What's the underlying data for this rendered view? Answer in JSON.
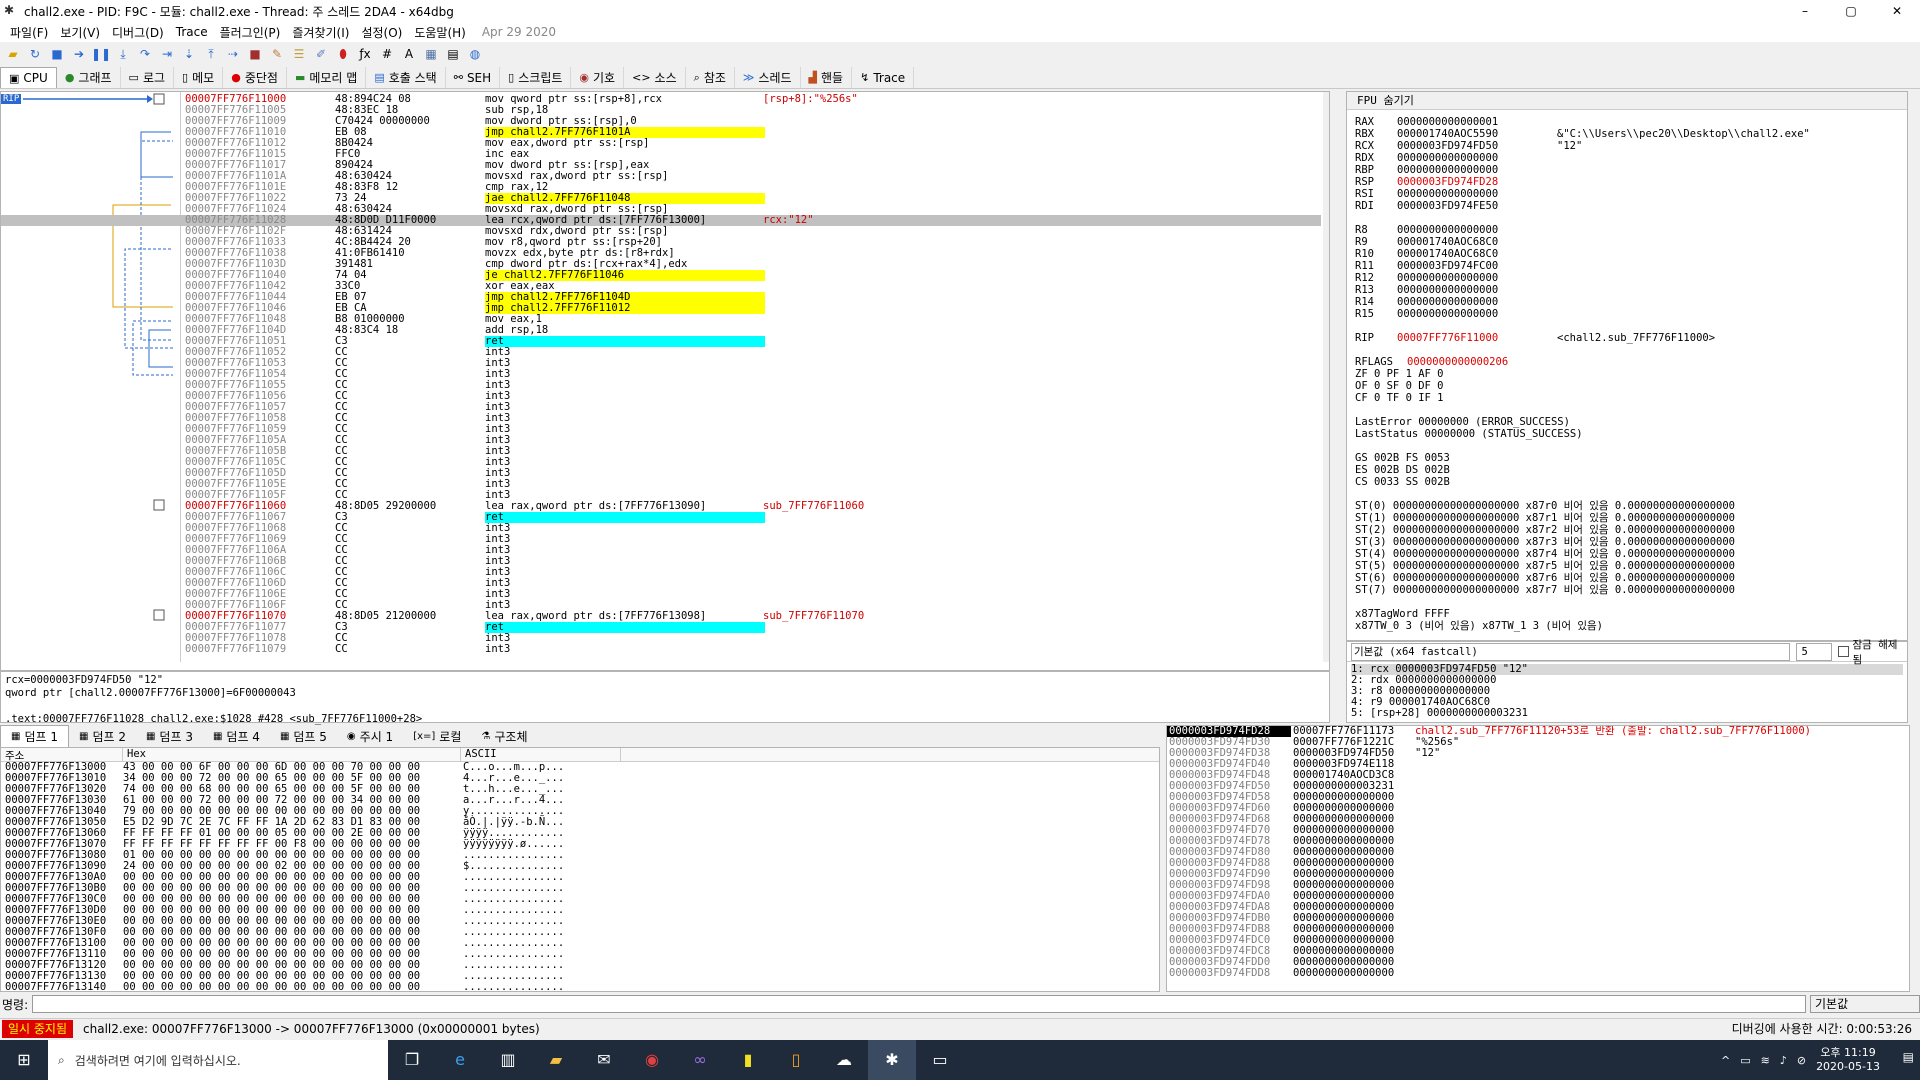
{
  "window": {
    "title": "chall2.exe - PID: F9C - 모듈: chall2.exe - Thread: 주 스레드 2DA4 - x64dbg",
    "minimize": "–",
    "maximize": "▢",
    "close": "✕"
  },
  "menu": [
    "파일(F)",
    "보기(V)",
    "디버그(D)",
    "Trace",
    "플러그인(P)",
    "즐겨찾기(I)",
    "설정(O)",
    "도움말(H)"
  ],
  "menu_date": "Apr 29 2020",
  "tabs": [
    {
      "label": "CPU",
      "icon": "cpu-icon"
    },
    {
      "label": "그래프",
      "icon": "graph-icon"
    },
    {
      "label": "로그",
      "icon": "log-icon"
    },
    {
      "label": "메모",
      "icon": "notes-icon"
    },
    {
      "label": "중단점",
      "icon": "breakpoint-icon"
    },
    {
      "label": "메모리 맵",
      "icon": "memory-map-icon"
    },
    {
      "label": "호출 스택",
      "icon": "call-stack-icon"
    },
    {
      "label": "SEH",
      "icon": "seh-icon"
    },
    {
      "label": "스크립트",
      "icon": "script-icon"
    },
    {
      "label": "기호",
      "icon": "symbols-icon"
    },
    {
      "label": "소스",
      "icon": "source-icon"
    },
    {
      "label": "참조",
      "icon": "references-icon"
    },
    {
      "label": "스레드",
      "icon": "threads-icon"
    },
    {
      "label": "핸들",
      "icon": "handles-icon"
    },
    {
      "label": "Trace",
      "icon": "trace-icon"
    }
  ],
  "rip_label": "RIP",
  "disasm": [
    {
      "addr": "00007FF776F11000",
      "bytes": "48:894C24 08",
      "dis": "mov qword ptr ss:[rsp+8],rcx",
      "cmt": "[rsp+8]:\"%256s\"",
      "red": true
    },
    {
      "addr": "00007FF776F11005",
      "bytes": "48:83EC 18",
      "dis": "sub rsp,18",
      "cmt": ""
    },
    {
      "addr": "00007FF776F11009",
      "bytes": "C70424 00000000",
      "dis": "mov dword ptr ss:[rsp],0",
      "cmt": ""
    },
    {
      "addr": "00007FF776F11010",
      "bytes": "EB 08",
      "dis": "jmp chall2.7FF776F1101A",
      "cmt": "",
      "jmp": true
    },
    {
      "addr": "00007FF776F11012",
      "bytes": "8B0424",
      "dis": "mov eax,dword ptr ss:[rsp]",
      "cmt": ""
    },
    {
      "addr": "00007FF776F11015",
      "bytes": "FFC0",
      "dis": "inc eax",
      "cmt": ""
    },
    {
      "addr": "00007FF776F11017",
      "bytes": "890424",
      "dis": "mov dword ptr ss:[rsp],eax",
      "cmt": ""
    },
    {
      "addr": "00007FF776F1101A",
      "bytes": "48:630424",
      "dis": "movsxd rax,dword ptr ss:[rsp]",
      "cmt": ""
    },
    {
      "addr": "00007FF776F1101E",
      "bytes": "48:83F8 12",
      "dis": "cmp rax,12",
      "cmt": ""
    },
    {
      "addr": "00007FF776F11022",
      "bytes": "73 24",
      "dis": "jae chall2.7FF776F11048",
      "cmt": "",
      "jmp": true
    },
    {
      "addr": "00007FF776F11024",
      "bytes": "48:630424",
      "dis": "movsxd rax,dword ptr ss:[rsp]",
      "cmt": ""
    },
    {
      "addr": "00007FF776F11028",
      "bytes": "48:8D0D D11F0000",
      "dis": "lea rcx,qword ptr ds:[7FF776F13000]",
      "cmt": "rcx:\"12\"",
      "hl": true
    },
    {
      "addr": "00007FF776F1102F",
      "bytes": "48:631424",
      "dis": "movsxd rdx,dword ptr ss:[rsp]",
      "cmt": ""
    },
    {
      "addr": "00007FF776F11033",
      "bytes": "4C:8B4424 20",
      "dis": "mov r8,qword ptr ss:[rsp+20]",
      "cmt": ""
    },
    {
      "addr": "00007FF776F11038",
      "bytes": "41:0FB61410",
      "dis": "movzx edx,byte ptr ds:[r8+rdx]",
      "cmt": ""
    },
    {
      "addr": "00007FF776F1103D",
      "bytes": "391481",
      "dis": "cmp dword ptr ds:[rcx+rax*4],edx",
      "cmt": ""
    },
    {
      "addr": "00007FF776F11040",
      "bytes": "74 04",
      "dis": "je chall2.7FF776F11046",
      "cmt": "",
      "jmp": true
    },
    {
      "addr": "00007FF776F11042",
      "bytes": "33C0",
      "dis": "xor eax,eax",
      "cmt": ""
    },
    {
      "addr": "00007FF776F11044",
      "bytes": "EB 07",
      "dis": "jmp chall2.7FF776F1104D",
      "cmt": "",
      "jmp": true
    },
    {
      "addr": "00007FF776F11046",
      "bytes": "EB CA",
      "dis": "jmp chall2.7FF776F11012",
      "cmt": "",
      "jmp": true
    },
    {
      "addr": "00007FF776F11048",
      "bytes": "B8 01000000",
      "dis": "mov eax,1",
      "cmt": ""
    },
    {
      "addr": "00007FF776F1104D",
      "bytes": "48:83C4 18",
      "dis": "add rsp,18",
      "cmt": ""
    },
    {
      "addr": "00007FF776F11051",
      "bytes": "C3",
      "dis": "ret",
      "cmt": "",
      "ret": true
    },
    {
      "addr": "00007FF776F11052",
      "bytes": "CC",
      "dis": "int3",
      "cmt": ""
    },
    {
      "addr": "00007FF776F11053",
      "bytes": "CC",
      "dis": "int3",
      "cmt": ""
    },
    {
      "addr": "00007FF776F11054",
      "bytes": "CC",
      "dis": "int3",
      "cmt": ""
    },
    {
      "addr": "00007FF776F11055",
      "bytes": "CC",
      "dis": "int3",
      "cmt": ""
    },
    {
      "addr": "00007FF776F11056",
      "bytes": "CC",
      "dis": "int3",
      "cmt": ""
    },
    {
      "addr": "00007FF776F11057",
      "bytes": "CC",
      "dis": "int3",
      "cmt": ""
    },
    {
      "addr": "00007FF776F11058",
      "bytes": "CC",
      "dis": "int3",
      "cmt": ""
    },
    {
      "addr": "00007FF776F11059",
      "bytes": "CC",
      "dis": "int3",
      "cmt": ""
    },
    {
      "addr": "00007FF776F1105A",
      "bytes": "CC",
      "dis": "int3",
      "cmt": ""
    },
    {
      "addr": "00007FF776F1105B",
      "bytes": "CC",
      "dis": "int3",
      "cmt": ""
    },
    {
      "addr": "00007FF776F1105C",
      "bytes": "CC",
      "dis": "int3",
      "cmt": ""
    },
    {
      "addr": "00007FF776F1105D",
      "bytes": "CC",
      "dis": "int3",
      "cmt": ""
    },
    {
      "addr": "00007FF776F1105E",
      "bytes": "CC",
      "dis": "int3",
      "cmt": ""
    },
    {
      "addr": "00007FF776F1105F",
      "bytes": "CC",
      "dis": "int3",
      "cmt": ""
    },
    {
      "addr": "00007FF776F11060",
      "bytes": "48:8D05 29200000",
      "dis": "lea rax,qword ptr ds:[7FF776F13090]",
      "cmt": "sub_7FF776F11060",
      "red": true
    },
    {
      "addr": "00007FF776F11067",
      "bytes": "C3",
      "dis": "ret",
      "cmt": "",
      "ret": true
    },
    {
      "addr": "00007FF776F11068",
      "bytes": "CC",
      "dis": "int3",
      "cmt": ""
    },
    {
      "addr": "00007FF776F11069",
      "bytes": "CC",
      "dis": "int3",
      "cmt": ""
    },
    {
      "addr": "00007FF776F1106A",
      "bytes": "CC",
      "dis": "int3",
      "cmt": ""
    },
    {
      "addr": "00007FF776F1106B",
      "bytes": "CC",
      "dis": "int3",
      "cmt": ""
    },
    {
      "addr": "00007FF776F1106C",
      "bytes": "CC",
      "dis": "int3",
      "cmt": ""
    },
    {
      "addr": "00007FF776F1106D",
      "bytes": "CC",
      "dis": "int3",
      "cmt": ""
    },
    {
      "addr": "00007FF776F1106E",
      "bytes": "CC",
      "dis": "int3",
      "cmt": ""
    },
    {
      "addr": "00007FF776F1106F",
      "bytes": "CC",
      "dis": "int3",
      "cmt": ""
    },
    {
      "addr": "00007FF776F11070",
      "bytes": "48:8D05 21200000",
      "dis": "lea rax,qword ptr ds:[7FF776F13098]",
      "cmt": "sub_7FF776F11070",
      "red": true
    },
    {
      "addr": "00007FF776F11077",
      "bytes": "C3",
      "dis": "ret",
      "cmt": "",
      "ret": true
    },
    {
      "addr": "00007FF776F11078",
      "bytes": "CC",
      "dis": "int3",
      "cmt": ""
    },
    {
      "addr": "00007FF776F11079",
      "bytes": "CC",
      "dis": "int3",
      "cmt": ""
    }
  ],
  "info": [
    "rcx=0000003FD974FD50 \"12\"",
    "qword ptr [chall2.00007FF776F13000]=6F00000043",
    "",
    ".text:00007FF776F11028 chall2.exe:$1028 #428 <sub_7FF776F11000+28>"
  ],
  "fpu": {
    "header": "FPU 숨기기",
    "regs1": [
      {
        "k": "RAX",
        "v": "0000000000000001",
        "c": ""
      },
      {
        "k": "RBX",
        "v": "000001740AOC5590",
        "c": "&\"C:\\\\Users\\\\pec20\\\\Desktop\\\\chall2.exe\""
      },
      {
        "k": "RCX",
        "v": "0000003FD974FD50",
        "c": "\"12\""
      },
      {
        "k": "RDX",
        "v": "0000000000000000",
        "c": ""
      },
      {
        "k": "RBP",
        "v": "0000000000000000",
        "c": ""
      },
      {
        "k": "RSP",
        "v": "0000003FD974FD28",
        "c": "",
        "red": true
      },
      {
        "k": "RSI",
        "v": "0000000000000000",
        "c": ""
      },
      {
        "k": "RDI",
        "v": "0000003FD974FE50",
        "c": ""
      }
    ],
    "regs2": [
      {
        "k": "R8",
        "v": "0000000000000000"
      },
      {
        "k": "R9",
        "v": "000001740AOC68C0"
      },
      {
        "k": "R10",
        "v": "000001740AOC68C0"
      },
      {
        "k": "R11",
        "v": "0000003FD974FC00"
      },
      {
        "k": "R12",
        "v": "0000000000000000"
      },
      {
        "k": "R13",
        "v": "0000000000000000"
      },
      {
        "k": "R14",
        "v": "0000000000000000"
      },
      {
        "k": "R15",
        "v": "0000000000000000"
      }
    ],
    "rip": {
      "k": "RIP",
      "v": "00007FF776F11000",
      "c": "<chall2.sub_7FF776F11000>"
    },
    "rflags": {
      "k": "RFLAGS",
      "v": "0000000000000206"
    },
    "flags": [
      "ZF 0  PF 1  AF 0",
      "OF 0  SF 0  DF 0",
      "CF 0  TF 0  IF 1"
    ],
    "errors": [
      "LastError  00000000 (ERROR_SUCCESS)",
      "LastStatus 00000000 (STATUS_SUCCESS)"
    ],
    "segs": [
      "GS 002B  FS 0053",
      "ES 002B  DS 002B",
      "CS 0033  SS 002B"
    ],
    "st": [
      "ST(0) 00000000000000000000 x87r0 비어 있음 0.00000000000000000",
      "ST(1) 00000000000000000000 x87r1 비어 있음 0.00000000000000000",
      "ST(2) 00000000000000000000 x87r2 비어 있음 0.00000000000000000",
      "ST(3) 00000000000000000000 x87r3 비어 있음 0.00000000000000000",
      "ST(4) 00000000000000000000 x87r4 비어 있음 0.00000000000000000",
      "ST(5) 00000000000000000000 x87r5 비어 있음 0.00000000000000000",
      "ST(6) 00000000000000000000 x87r6 비어 있음 0.00000000000000000",
      "ST(7) 00000000000000000000 x87r7 비어 있음 0.00000000000000000"
    ],
    "tag": [
      "x87TagWord FFFF",
      "x87TW_0 3 (비어 있음) x87TW_1 3 (비어 있음)"
    ]
  },
  "callconv": {
    "select": "기본값 (x64 fastcall)",
    "count": "5",
    "lock": "잠금 해제됨",
    "lines": [
      "1: rcx 0000003FD974FD50 \"12\"",
      "2: rdx 0000000000000000",
      "3: r8 0000000000000000",
      "4: r9 000001740AOC68C0",
      "5: [rsp+28] 0000000000003231"
    ]
  },
  "dumptabs": [
    "덤프 1",
    "덤프 2",
    "덤프 3",
    "덤프 4",
    "덤프 5",
    "주시 1",
    "로컬",
    "구조체"
  ],
  "dump_head": {
    "addr": "주소",
    "hex": "Hex",
    "ascii": "ASCII"
  },
  "dump": [
    {
      "a": "00007FF776F13000",
      "h": "43 00 00 00 6F 00 00 00 6D 00 00 00 70 00 00 00",
      "s": "C...o...m...p..."
    },
    {
      "a": "00007FF776F13010",
      "h": "34 00 00 00 72 00 00 00 65 00 00 00 5F 00 00 00",
      "s": "4...r...e..._..."
    },
    {
      "a": "00007FF776F13020",
      "h": "74 00 00 00 68 00 00 00 65 00 00 00 5F 00 00 00",
      "s": "t...h...e..._..."
    },
    {
      "a": "00007FF776F13030",
      "h": "61 00 00 00 72 00 00 00 72 00 00 00 34 00 00 00",
      "s": "a...r...r...4..."
    },
    {
      "a": "00007FF776F13040",
      "h": "79 00 00 00 00 00 00 00 00 00 00 00 00 00 00 00",
      "s": "y..............."
    },
    {
      "a": "00007FF776F13050",
      "h": "E5 D2 9D 7C 2E 7C FF FF 1A 2D 62 83 D1 83 00 00",
      "s": "åÒ.|.|ÿÿ.-b.Ñ..."
    },
    {
      "a": "00007FF776F13060",
      "h": "FF FF FF FF 01 00 00 00 05 00 00 00 2E 00 00 00",
      "s": "ÿÿÿÿ............"
    },
    {
      "a": "00007FF776F13070",
      "h": "FF FF FF FF FF FF FF FF 00 F8 00 00 00 00 00 00",
      "s": "ÿÿÿÿÿÿÿÿ.ø......"
    },
    {
      "a": "00007FF776F13080",
      "h": "01 00 00 00 00 00 00 00 00 00 00 00 00 00 00 00",
      "s": "................"
    },
    {
      "a": "00007FF776F13090",
      "h": "24 00 00 00 00 00 00 00 02 00 00 00 00 00 00 00",
      "s": "$..............."
    },
    {
      "a": "00007FF776F130A0",
      "h": "00 00 00 00 00 00 00 00 00 00 00 00 00 00 00 00",
      "s": "................"
    },
    {
      "a": "00007FF776F130B0",
      "h": "00 00 00 00 00 00 00 00 00 00 00 00 00 00 00 00",
      "s": "................"
    },
    {
      "a": "00007FF776F130C0",
      "h": "00 00 00 00 00 00 00 00 00 00 00 00 00 00 00 00",
      "s": "................"
    },
    {
      "a": "00007FF776F130D0",
      "h": "00 00 00 00 00 00 00 00 00 00 00 00 00 00 00 00",
      "s": "................"
    },
    {
      "a": "00007FF776F130E0",
      "h": "00 00 00 00 00 00 00 00 00 00 00 00 00 00 00 00",
      "s": "................"
    },
    {
      "a": "00007FF776F130F0",
      "h": "00 00 00 00 00 00 00 00 00 00 00 00 00 00 00 00",
      "s": "................"
    },
    {
      "a": "00007FF776F13100",
      "h": "00 00 00 00 00 00 00 00 00 00 00 00 00 00 00 00",
      "s": "................"
    },
    {
      "a": "00007FF776F13110",
      "h": "00 00 00 00 00 00 00 00 00 00 00 00 00 00 00 00",
      "s": "................"
    },
    {
      "a": "00007FF776F13120",
      "h": "00 00 00 00 00 00 00 00 00 00 00 00 00 00 00 00",
      "s": "................"
    },
    {
      "a": "00007FF776F13130",
      "h": "00 00 00 00 00 00 00 00 00 00 00 00 00 00 00 00",
      "s": "................"
    },
    {
      "a": "00007FF776F13140",
      "h": "00 00 00 00 00 00 00 00 00 00 00 00 00 00 00 00",
      "s": "................"
    }
  ],
  "stack": [
    {
      "a": "0000003FD974FD28",
      "v": "00007FF776F11173",
      "c": "chall2.sub_7FF776F11120+53로 반환 (출발: chall2.sub_7FF776F11000)",
      "sel": true
    },
    {
      "a": "0000003FD974FD30",
      "v": "00007FF776F1221C",
      "c": "\"%256s\""
    },
    {
      "a": "0000003FD974FD38",
      "v": "0000003FD974FD50",
      "c": "\"12\""
    },
    {
      "a": "0000003FD974FD40",
      "v": "0000003FD974E118",
      "c": ""
    },
    {
      "a": "0000003FD974FD48",
      "v": "000001740AOCD3C8",
      "c": ""
    },
    {
      "a": "0000003FD974FD50",
      "v": "0000000000003231",
      "c": ""
    },
    {
      "a": "0000003FD974FD58",
      "v": "0000000000000000",
      "c": ""
    },
    {
      "a": "0000003FD974FD60",
      "v": "0000000000000000",
      "c": ""
    },
    {
      "a": "0000003FD974FD68",
      "v": "0000000000000000",
      "c": ""
    },
    {
      "a": "0000003FD974FD70",
      "v": "0000000000000000",
      "c": ""
    },
    {
      "a": "0000003FD974FD78",
      "v": "0000000000000000",
      "c": ""
    },
    {
      "a": "0000003FD974FD80",
      "v": "0000000000000000",
      "c": ""
    },
    {
      "a": "0000003FD974FD88",
      "v": "0000000000000000",
      "c": ""
    },
    {
      "a": "0000003FD974FD90",
      "v": "0000000000000000",
      "c": ""
    },
    {
      "a": "0000003FD974FD98",
      "v": "0000000000000000",
      "c": ""
    },
    {
      "a": "0000003FD974FDA0",
      "v": "0000000000000000",
      "c": ""
    },
    {
      "a": "0000003FD974FDA8",
      "v": "0000000000000000",
      "c": ""
    },
    {
      "a": "0000003FD974FDB0",
      "v": "0000000000000000",
      "c": ""
    },
    {
      "a": "0000003FD974FDB8",
      "v": "0000000000000000",
      "c": ""
    },
    {
      "a": "0000003FD974FDC0",
      "v": "0000000000000000",
      "c": ""
    },
    {
      "a": "0000003FD974FDC8",
      "v": "0000000000000000",
      "c": ""
    },
    {
      "a": "0000003FD974FDD0",
      "v": "0000000000000000",
      "c": ""
    },
    {
      "a": "0000003FD974FDD8",
      "v": "0000000000000000",
      "c": ""
    }
  ],
  "cmd": {
    "label": "명령:",
    "default": "기본값"
  },
  "status": {
    "state": "일시 중지됨",
    "msg": "chall2.exe: 00007FF776F13000 -> 00007FF776F13000 (0x00000001 bytes)",
    "time": "디버깅에 사용한 시간: 0:00:53:26"
  },
  "taskbar": {
    "search": "검색하려면 여기에 입력하십시오.",
    "time": "오후 11:19",
    "date": "2020-05-13"
  }
}
